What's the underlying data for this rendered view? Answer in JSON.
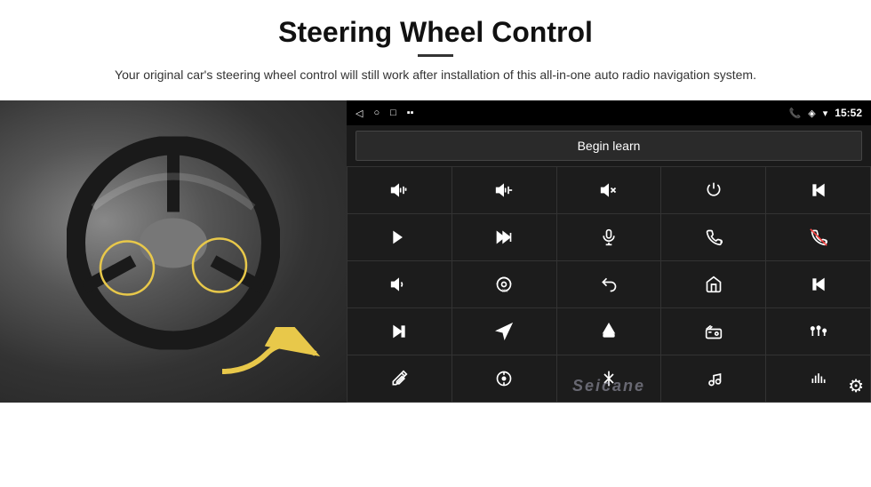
{
  "header": {
    "title": "Steering Wheel Control",
    "subtitle": "Your original car's steering wheel control will still work after installation of this all-in-one auto radio navigation system."
  },
  "status_bar": {
    "time": "15:52",
    "icons": [
      "back-arrow",
      "home-circle",
      "square-recent",
      "notification-icon",
      "signal-icon"
    ],
    "right_icons": [
      "phone-icon",
      "location-icon",
      "wifi-icon"
    ]
  },
  "begin_learn": {
    "label": "Begin learn"
  },
  "controls": [
    {
      "icon": "vol-up",
      "symbol": "🔊+"
    },
    {
      "icon": "vol-down",
      "symbol": "🔊-"
    },
    {
      "icon": "mute",
      "symbol": "🔇"
    },
    {
      "icon": "power",
      "symbol": "⏻"
    },
    {
      "icon": "prev-track",
      "symbol": "⏮"
    },
    {
      "icon": "next",
      "symbol": "⏭"
    },
    {
      "icon": "ff-skip",
      "symbol": "⏭⏭"
    },
    {
      "icon": "mic",
      "symbol": "🎤"
    },
    {
      "icon": "phone-call",
      "symbol": "📞"
    },
    {
      "icon": "hang-up",
      "symbol": "📵"
    },
    {
      "icon": "speaker",
      "symbol": "🔈"
    },
    {
      "icon": "360-camera",
      "symbol": "360"
    },
    {
      "icon": "back",
      "symbol": "↩"
    },
    {
      "icon": "home",
      "symbol": "⌂"
    },
    {
      "icon": "skip-back",
      "symbol": "⏮⏮"
    },
    {
      "icon": "fast-forward",
      "symbol": "⏭"
    },
    {
      "icon": "navigate",
      "symbol": "➤"
    },
    {
      "icon": "eject",
      "symbol": "⏏"
    },
    {
      "icon": "radio",
      "symbol": "📻"
    },
    {
      "icon": "equalizer",
      "symbol": "🎛"
    },
    {
      "icon": "pen",
      "symbol": "✏"
    },
    {
      "icon": "settings-circle",
      "symbol": "⚙"
    },
    {
      "icon": "bluetooth",
      "symbol": "🅱"
    },
    {
      "icon": "music",
      "symbol": "🎵"
    },
    {
      "icon": "bars",
      "symbol": "📊"
    }
  ],
  "watermark": {
    "text": "Seicane"
  },
  "colors": {
    "panel_bg": "#111111",
    "status_bg": "#000000",
    "btn_bg": "#1c1c1c",
    "grid_gap": "#333333",
    "text_color": "#ffffff",
    "accent_yellow": "#e8c84a"
  }
}
